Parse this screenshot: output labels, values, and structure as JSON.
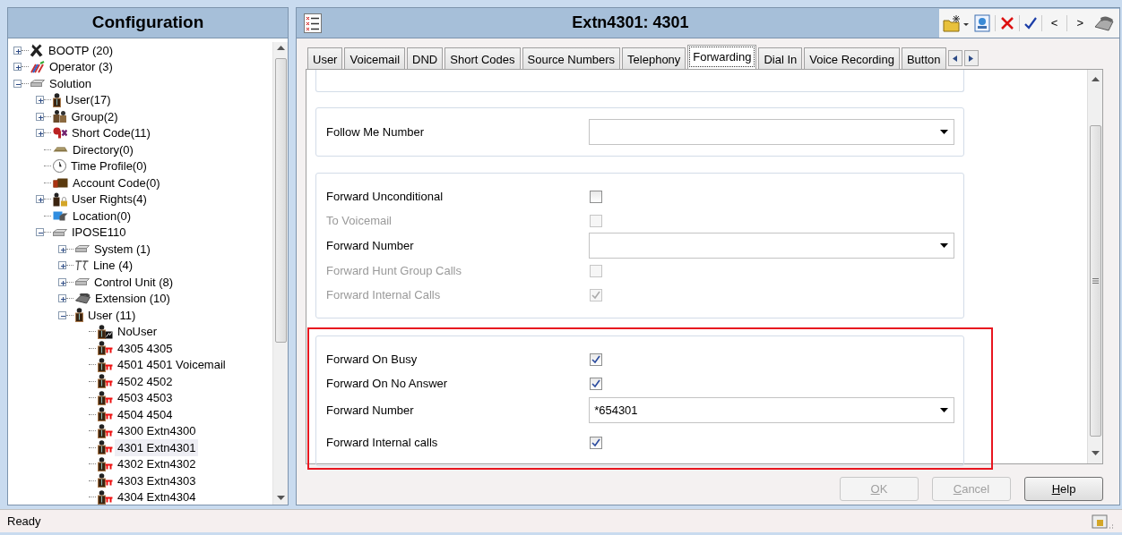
{
  "sidebar": {
    "title": "Configuration",
    "tree": [
      {
        "label": "BOOTP (20)",
        "kind": "bootp",
        "expanded": false,
        "selected": false
      },
      {
        "label": "Operator (3)",
        "kind": "operator",
        "expanded": false,
        "selected": false
      },
      {
        "label": "Solution",
        "kind": "device",
        "expanded": true,
        "selected": false,
        "children": [
          {
            "label": "User(17)",
            "kind": "user",
            "expanded": false,
            "selected": false
          },
          {
            "label": "Group(2)",
            "kind": "group",
            "expanded": false,
            "selected": false
          },
          {
            "label": "Short Code(11)",
            "kind": "shortcode",
            "expanded": false,
            "selected": false
          },
          {
            "label": "Directory(0)",
            "kind": "directory",
            "selected": false
          },
          {
            "label": "Time Profile(0)",
            "kind": "clock",
            "selected": false
          },
          {
            "label": "Account Code(0)",
            "kind": "account",
            "selected": false
          },
          {
            "label": "User Rights(4)",
            "kind": "rights",
            "expanded": false,
            "selected": false
          },
          {
            "label": "Location(0)",
            "kind": "location",
            "selected": false
          },
          {
            "label": "IPOSE110",
            "kind": "device",
            "expanded": true,
            "selected": false,
            "children": [
              {
                "label": "System (1)",
                "kind": "device",
                "expanded": false,
                "selected": false
              },
              {
                "label": "Line (4)",
                "kind": "line",
                "expanded": false,
                "selected": false
              },
              {
                "label": "Control Unit (8)",
                "kind": "device",
                "expanded": false,
                "selected": false
              },
              {
                "label": "Extension (10)",
                "kind": "phone",
                "expanded": false,
                "selected": false
              },
              {
                "label": "User (11)",
                "kind": "user",
                "expanded": true,
                "selected": false,
                "children": [
                  {
                    "label": "NoUser",
                    "kind": "nouser",
                    "selected": false
                  },
                  {
                    "label": "4305 4305",
                    "kind": "userphone",
                    "selected": false
                  },
                  {
                    "label": "4501 4501 Voicemail",
                    "kind": "userphone",
                    "selected": false
                  },
                  {
                    "label": "4502 4502",
                    "kind": "userphone",
                    "selected": false
                  },
                  {
                    "label": "4503 4503",
                    "kind": "userphone",
                    "selected": false
                  },
                  {
                    "label": "4504 4504",
                    "kind": "userphone",
                    "selected": false
                  },
                  {
                    "label": "4300 Extn4300",
                    "kind": "userphone",
                    "selected": false
                  },
                  {
                    "label": "4301 Extn4301",
                    "kind": "userphone",
                    "selected": true
                  },
                  {
                    "label": "4302 Extn4302",
                    "kind": "userphone",
                    "selected": false
                  },
                  {
                    "label": "4303 Extn4303",
                    "kind": "userphone",
                    "selected": false
                  },
                  {
                    "label": "4304 Extn4304",
                    "kind": "userphone",
                    "selected": false
                  }
                ]
              }
            ]
          }
        ]
      }
    ]
  },
  "editor": {
    "title": "Extn4301: 4301",
    "nav_buttons": [
      "<",
      ">"
    ],
    "tabs": [
      {
        "label": "User",
        "selected": false
      },
      {
        "label": "Voicemail",
        "selected": false
      },
      {
        "label": "DND",
        "selected": false
      },
      {
        "label": "Short Codes",
        "selected": false
      },
      {
        "label": "Source Numbers",
        "selected": false
      },
      {
        "label": "Telephony",
        "selected": false
      },
      {
        "label": "Forwarding",
        "selected": true
      },
      {
        "label": "Dial In",
        "selected": false
      },
      {
        "label": "Voice Recording",
        "selected": false
      },
      {
        "label": "Button",
        "selected": false
      }
    ],
    "groups": [
      {
        "highlighted": false,
        "rows": [
          {
            "kind": "dropdown",
            "label": "Follow Me Number",
            "disabled": false
          }
        ]
      },
      {
        "highlighted": false,
        "rows": [
          {
            "kind": "checkbox",
            "label": "Forward Unconditional",
            "disabled": false,
            "checked": false
          },
          {
            "kind": "checkbox",
            "label": "To Voicemail",
            "disabled": true,
            "checked": false
          },
          {
            "kind": "dropdown",
            "label": "Forward Number",
            "disabled": false
          },
          {
            "kind": "checkbox",
            "label": "Forward Hunt Group Calls",
            "disabled": true,
            "checked": false
          },
          {
            "kind": "checkbox",
            "label": "Forward Internal Calls",
            "disabled": true,
            "checked": true
          }
        ]
      },
      {
        "highlighted": true,
        "rows": [
          {
            "kind": "checkbox",
            "label": "Forward On Busy",
            "disabled": false,
            "checked": true
          },
          {
            "kind": "checkbox",
            "label": "Forward On No Answer",
            "disabled": false,
            "checked": true
          },
          {
            "kind": "dropdown",
            "label": "Forward Number",
            "disabled": false,
            "value": "*654301"
          },
          {
            "kind": "checkbox",
            "label": "Forward Internal calls",
            "disabled": false,
            "checked": true
          }
        ]
      }
    ],
    "buttons": [
      {
        "label": "OK",
        "disabled": true
      },
      {
        "label": "Cancel",
        "disabled": true
      },
      {
        "label": "Help",
        "disabled": false
      }
    ]
  },
  "status_bar": {
    "text": "Ready"
  }
}
